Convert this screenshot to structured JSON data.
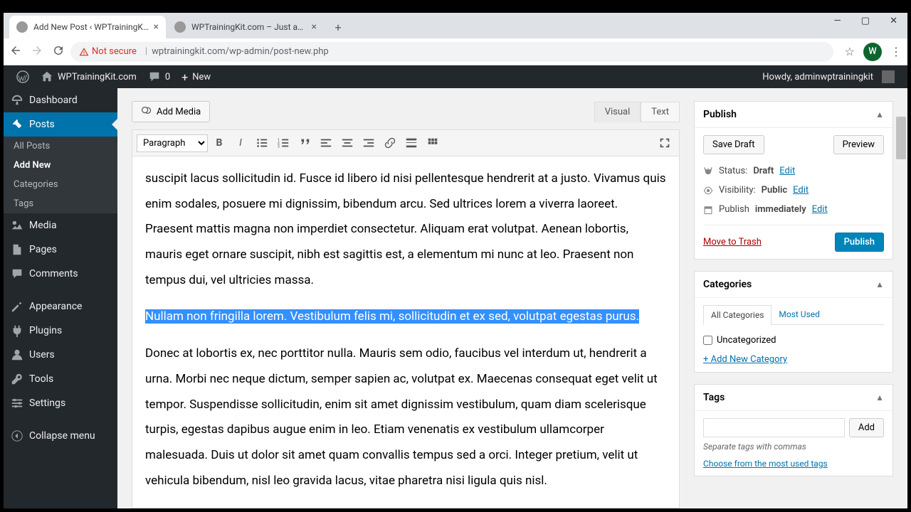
{
  "browser": {
    "tabs": [
      {
        "title": "Add New Post ‹ WPTrainingKit.co",
        "active": true
      },
      {
        "title": "WPTrainingKit.com – Just anothe",
        "active": false
      }
    ],
    "security_warning": "Not secure",
    "url": "wptrainingkit.com/wp-admin/post-new.php",
    "avatar_letter": "W"
  },
  "adminbar": {
    "site_name": "WPTrainingKit.com",
    "comments_count": "0",
    "new_label": "New",
    "howdy": "Howdy, adminwptrainingkit"
  },
  "sidebar": {
    "items": [
      {
        "label": "Dashboard",
        "icon": "dashboard"
      },
      {
        "label": "Posts",
        "icon": "pin",
        "current": true,
        "sub": [
          {
            "label": "All Posts"
          },
          {
            "label": "Add New",
            "current": true
          },
          {
            "label": "Categories"
          },
          {
            "label": "Tags"
          }
        ]
      },
      {
        "label": "Media",
        "icon": "media"
      },
      {
        "label": "Pages",
        "icon": "pages"
      },
      {
        "label": "Comments",
        "icon": "comments"
      },
      {
        "label": "Appearance",
        "icon": "appearance"
      },
      {
        "label": "Plugins",
        "icon": "plugins"
      },
      {
        "label": "Users",
        "icon": "users"
      },
      {
        "label": "Tools",
        "icon": "tools"
      },
      {
        "label": "Settings",
        "icon": "settings"
      },
      {
        "label": "Collapse menu",
        "icon": "collapse"
      }
    ]
  },
  "editor": {
    "add_media": "Add Media",
    "tab_visual": "Visual",
    "tab_text": "Text",
    "format": "Paragraph",
    "content": {
      "p1": "suscipit lacus sollicitudin id. Fusce id libero id nisi pellentesque hendrerit at a justo. Vivamus quis enim sodales, posuere mi dignissim, bibendum arcu. Sed ultrices lorem a viverra laoreet. Praesent mattis magna non imperdiet consectetur. Aliquam erat volutpat. Aenean lobortis, mauris eget ornare suscipit, nibh est sagittis est, a elementum mi nunc at leo. Praesent non tempus dui, vel ultricies massa.",
      "p2_selected": "Nullam non fringilla lorem. Vestibulum felis mi, sollicitudin et ex sed, volutpat egestas purus.",
      "p3": "Donec at lobortis ex, nec porttitor nulla. Mauris sem odio, faucibus vel interdum ut, hendrerit a urna. Morbi nec neque dictum, semper sapien ac, volutpat ex. Maecenas consequat eget velit ut tempor. Suspendisse sollicitudin, enim sit amet dignissim vestibulum, quam diam scelerisque turpis, egestas dapibus augue enim in leo. Etiam venenatis ex vestibulum ullamcorper malesuada. Duis ut dolor sit amet quam convallis tempus sed a orci. Integer pretium, velit ut vehicula bibendum, nisl leo gravida lacus, vitae pharetra nisi ligula quis nisl."
    }
  },
  "publish": {
    "title": "Publish",
    "save_draft": "Save Draft",
    "preview": "Preview",
    "status_label": "Status:",
    "status_value": "Draft",
    "visibility_label": "Visibility:",
    "visibility_value": "Public",
    "publish_label": "Publish",
    "publish_value": "immediately",
    "edit": "Edit",
    "trash": "Move to Trash",
    "publish_btn": "Publish"
  },
  "categories": {
    "title": "Categories",
    "tab_all": "All Categories",
    "tab_most": "Most Used",
    "items": [
      "Uncategorized"
    ],
    "add_new": "+ Add New Category"
  },
  "tags": {
    "title": "Tags",
    "add_btn": "Add",
    "hint": "Separate tags with commas",
    "choose": "Choose from the most used tags"
  }
}
